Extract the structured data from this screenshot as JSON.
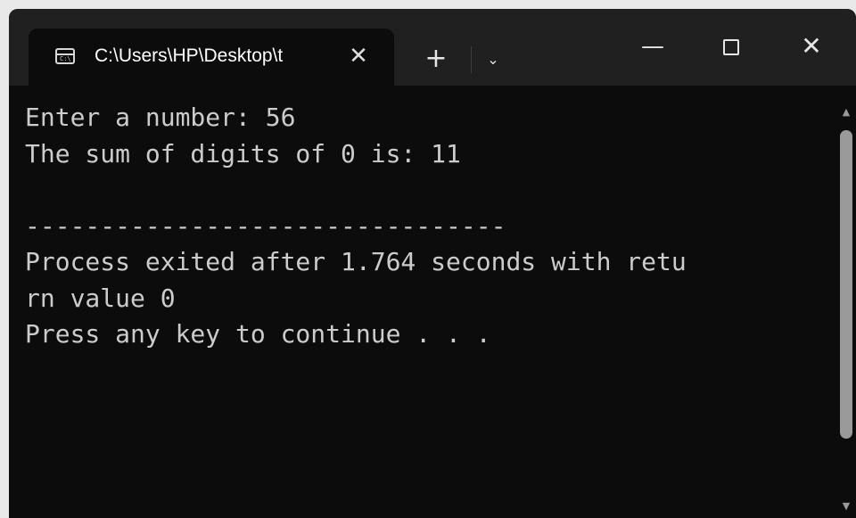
{
  "tab": {
    "icon": "console-icon",
    "icon_text": "C:\\",
    "title": "C:\\Users\\HP\\Desktop\\t",
    "close_glyph": "✕"
  },
  "titlebar": {
    "new_tab_glyph": "+",
    "dropdown_glyph": "⌄",
    "minimize_glyph": "—",
    "close_glyph": "✕"
  },
  "terminal": {
    "lines": [
      "Enter a number: 56",
      "The sum of digits of 0 is: 11",
      "",
      "--------------------------------",
      "Process exited after 1.764 seconds with retu",
      "rn value 0",
      "Press any key to continue . . ."
    ]
  },
  "scrollbar": {
    "up_glyph": "▲",
    "down_glyph": "▼"
  },
  "colors": {
    "background": "#0c0c0c",
    "titlebar": "#202020",
    "text": "#cccccc"
  }
}
